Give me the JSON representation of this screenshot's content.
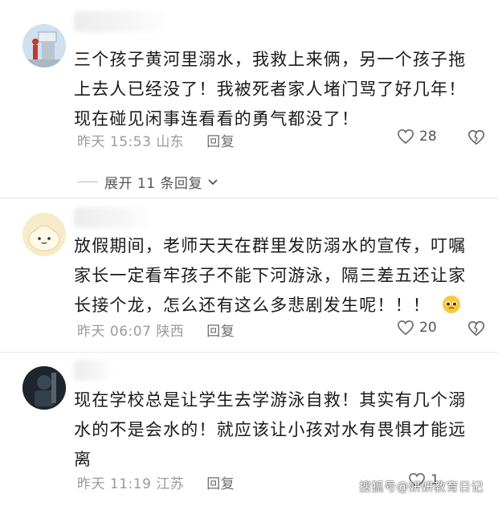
{
  "comments": [
    {
      "text_lines": [
        "三个孩子黄河里溺水，我救上来俩，另一个孩子拖",
        "上去人已经没了！我被死者家人堵门骂了好几年！",
        "现在碰见闲事连看看的勇气都没了！"
      ],
      "time": "昨天 15:53",
      "region": "山东",
      "reply_label": "回复",
      "likes": "28"
    },
    {
      "text_lines": [
        "放假期间，老师天天在群里发防溺水的宣传，叮嘱",
        "家长一定看牢孩子不能下河游泳，隔三差五还让家",
        "长接个龙，怎么还有这么多悲剧发生呢！！！"
      ],
      "time": "昨天 06:07",
      "region": "陕西",
      "reply_label": "回复",
      "likes": "20"
    },
    {
      "text_lines": [
        "现在学校总是让学生去学游泳自救！其实有几个溺",
        "水的不是会水的！就应该让小孩对水有畏惧才能远",
        "离"
      ],
      "time": "昨天 11:19",
      "region": "江苏",
      "reply_label": "回复",
      "likes": "1"
    }
  ],
  "expand_replies": "展开 11 条回复",
  "watermark": "搜狐号@妍妍教育日记"
}
